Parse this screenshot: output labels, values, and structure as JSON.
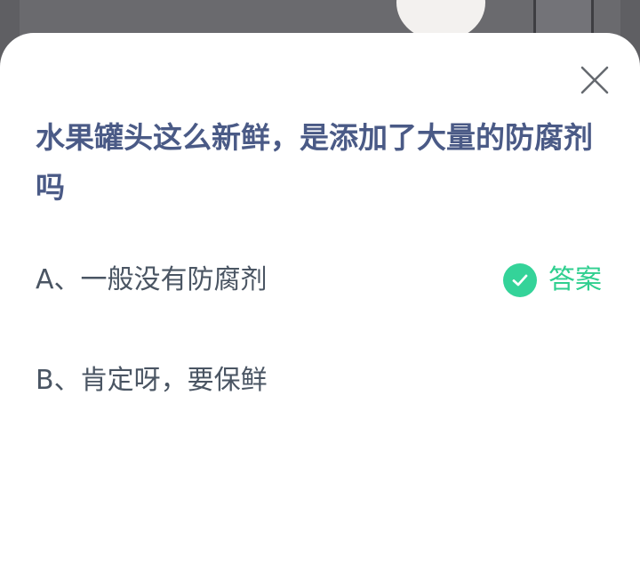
{
  "question": {
    "text": "水果罐头这么新鲜，是添加了大量的防腐剂吗"
  },
  "options": [
    {
      "label": "A、一般没有防腐剂",
      "is_answer": true
    },
    {
      "label": "B、肯定呀，要保鲜",
      "is_answer": false
    }
  ],
  "answer_badge": {
    "label": "答案",
    "icon": "check-circle-icon",
    "color": "#34d399"
  },
  "close_icon": "close-icon",
  "colors": {
    "question": "#4a5a86",
    "option_text": "#4a5563",
    "accent": "#34d399"
  }
}
